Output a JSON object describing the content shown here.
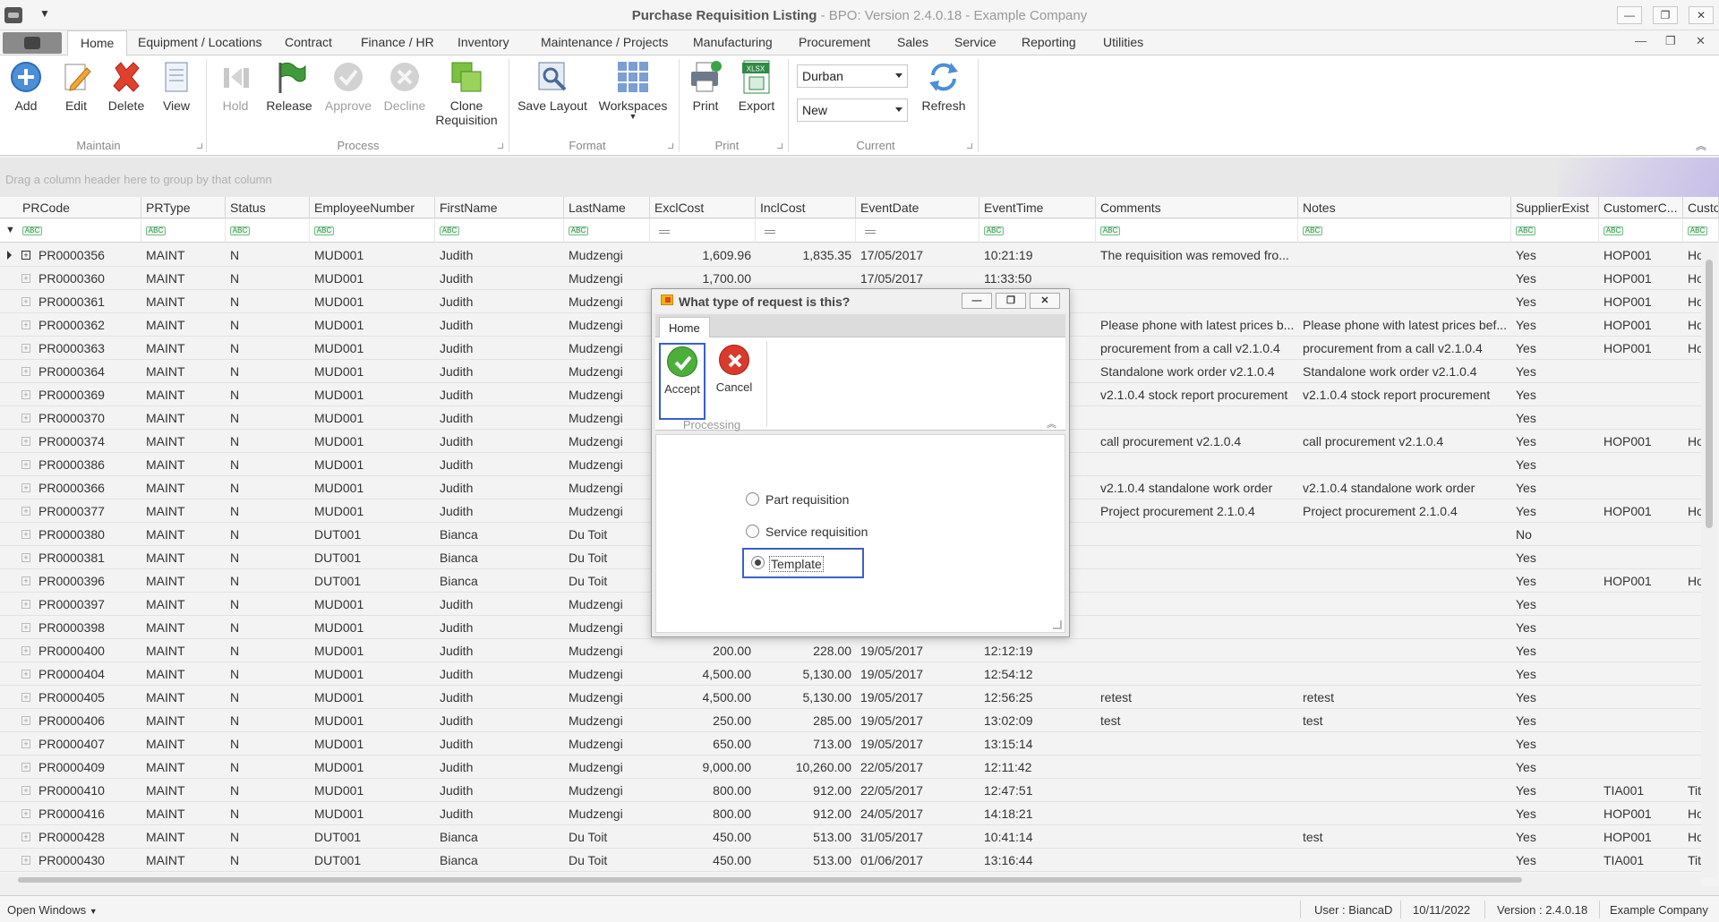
{
  "window": {
    "title": "Purchase Requisition Listing",
    "subtitle": " - BPO: Version 2.4.0.18 - Example Company",
    "min": "—",
    "restore": "❐",
    "close": "✕"
  },
  "menu_tabs": [
    "Home",
    "Equipment / Locations",
    "Contract",
    "Finance / HR",
    "Inventory",
    "Maintenance / Projects",
    "Manufacturing",
    "Procurement",
    "Sales",
    "Service",
    "Reporting",
    "Utilities"
  ],
  "ribbon": {
    "maintain": {
      "label": "Maintain",
      "buttons": [
        "Add",
        "Edit",
        "Delete",
        "View"
      ]
    },
    "process": {
      "label": "Process",
      "buttons": [
        "Hold",
        "Release",
        "Approve",
        "Decline",
        "Clone Requisition"
      ]
    },
    "format": {
      "label": "Format",
      "buttons": [
        "Save Layout",
        "Workspaces"
      ]
    },
    "print": {
      "label": "Print",
      "buttons": [
        "Print",
        "Export"
      ]
    },
    "current": {
      "label": "Current",
      "site": "Durban",
      "status": "New",
      "refresh": "Refresh"
    },
    "export_badge": "XLSX"
  },
  "group_panel_hint": "Drag a column header here to group by that column",
  "grid": {
    "columns": [
      "PRCode",
      "PRType",
      "Status",
      "EmployeeNumber",
      "FirstName",
      "LastName",
      "ExclCost",
      "InclCost",
      "EventDate",
      "EventTime",
      "Comments",
      "Notes",
      "SupplierExist",
      "CustomerC...",
      "Custo"
    ],
    "rows": [
      [
        "PR0000356",
        "MAINT",
        "N",
        "MUD001",
        "Judith",
        "Mudzengi",
        "1,609.96",
        "1,835.35",
        "17/05/2017",
        "10:21:19",
        "The requisition was removed fro...",
        "",
        "Yes",
        "HOP001",
        "Ho"
      ],
      [
        "PR0000360",
        "MAINT",
        "N",
        "MUD001",
        "Judith",
        "Mudzengi",
        "1,700.00",
        "",
        "17/05/2017",
        "11:33:50",
        "",
        "",
        "Yes",
        "HOP001",
        "Ho"
      ],
      [
        "PR0000361",
        "MAINT",
        "N",
        "MUD001",
        "Judith",
        "Mudzengi",
        "",
        "",
        "",
        "",
        "",
        "",
        "Yes",
        "HOP001",
        "Ho"
      ],
      [
        "PR0000362",
        "MAINT",
        "N",
        "MUD001",
        "Judith",
        "Mudzengi",
        "",
        "",
        "",
        "",
        "Please phone with latest prices b...",
        "Please phone with latest prices bef...",
        "Yes",
        "HOP001",
        "Ho"
      ],
      [
        "PR0000363",
        "MAINT",
        "N",
        "MUD001",
        "Judith",
        "Mudzengi",
        "",
        "",
        "",
        "",
        "procurement from a call v2.1.0.4",
        "procurement from a call v2.1.0.4",
        "Yes",
        "HOP001",
        "Ho"
      ],
      [
        "PR0000364",
        "MAINT",
        "N",
        "MUD001",
        "Judith",
        "Mudzengi",
        "",
        "",
        "",
        "",
        "Standalone work order  v2.1.0.4",
        "Standalone work order v2.1.0.4",
        "Yes",
        "",
        ""
      ],
      [
        "PR0000369",
        "MAINT",
        "N",
        "MUD001",
        "Judith",
        "Mudzengi",
        "",
        "",
        "",
        "",
        "v2.1.0.4 stock report procurement",
        "v2.1.0.4 stock report procurement",
        "Yes",
        "",
        ""
      ],
      [
        "PR0000370",
        "MAINT",
        "N",
        "MUD001",
        "Judith",
        "Mudzengi",
        "",
        "",
        "",
        "",
        "",
        "",
        "Yes",
        "",
        ""
      ],
      [
        "PR0000374",
        "MAINT",
        "N",
        "MUD001",
        "Judith",
        "Mudzengi",
        "",
        "",
        "",
        "",
        "call procurement v2.1.0.4",
        "call procurement v2.1.0.4",
        "Yes",
        "HOP001",
        "Ho"
      ],
      [
        "PR0000386",
        "MAINT",
        "N",
        "MUD001",
        "Judith",
        "Mudzengi",
        "",
        "",
        "",
        "",
        "",
        "",
        "Yes",
        "",
        ""
      ],
      [
        "PR0000366",
        "MAINT",
        "N",
        "MUD001",
        "Judith",
        "Mudzengi",
        "",
        "",
        "",
        "",
        "v2.1.0.4 standalone work order",
        "v2.1.0.4 standalone work order",
        "Yes",
        "",
        ""
      ],
      [
        "PR0000377",
        "MAINT",
        "N",
        "MUD001",
        "Judith",
        "Mudzengi",
        "",
        "",
        "",
        "",
        "Project procurement 2.1.0.4",
        "Project procurement 2.1.0.4",
        "Yes",
        "HOP001",
        "Ho"
      ],
      [
        "PR0000380",
        "MAINT",
        "N",
        "DUT001",
        "Bianca",
        "Du Toit",
        "",
        "",
        "",
        "",
        "",
        "",
        "No",
        "",
        ""
      ],
      [
        "PR0000381",
        "MAINT",
        "N",
        "DUT001",
        "Bianca",
        "Du Toit",
        "",
        "",
        "",
        "",
        "",
        "",
        "Yes",
        "",
        ""
      ],
      [
        "PR0000396",
        "MAINT",
        "N",
        "DUT001",
        "Bianca",
        "Du Toit",
        "",
        "",
        "",
        "",
        "",
        "",
        "Yes",
        "HOP001",
        "Ho"
      ],
      [
        "PR0000397",
        "MAINT",
        "N",
        "MUD001",
        "Judith",
        "Mudzengi",
        "",
        "",
        "",
        "",
        "",
        "",
        "Yes",
        "",
        ""
      ],
      [
        "PR0000398",
        "MAINT",
        "N",
        "MUD001",
        "Judith",
        "Mudzengi",
        "",
        "",
        "",
        "",
        "",
        "",
        "Yes",
        "",
        ""
      ],
      [
        "PR0000400",
        "MAINT",
        "N",
        "MUD001",
        "Judith",
        "Mudzengi",
        "200.00",
        "228.00",
        "19/05/2017",
        "12:12:19",
        "",
        "",
        "Yes",
        "",
        ""
      ],
      [
        "PR0000404",
        "MAINT",
        "N",
        "MUD001",
        "Judith",
        "Mudzengi",
        "4,500.00",
        "5,130.00",
        "19/05/2017",
        "12:54:12",
        "",
        "",
        "Yes",
        "",
        ""
      ],
      [
        "PR0000405",
        "MAINT",
        "N",
        "MUD001",
        "Judith",
        "Mudzengi",
        "4,500.00",
        "5,130.00",
        "19/05/2017",
        "12:56:25",
        "retest",
        "retest",
        "Yes",
        "",
        ""
      ],
      [
        "PR0000406",
        "MAINT",
        "N",
        "MUD001",
        "Judith",
        "Mudzengi",
        "250.00",
        "285.00",
        "19/05/2017",
        "13:02:09",
        "test",
        "test",
        "Yes",
        "",
        ""
      ],
      [
        "PR0000407",
        "MAINT",
        "N",
        "MUD001",
        "Judith",
        "Mudzengi",
        "650.00",
        "713.00",
        "19/05/2017",
        "13:15:14",
        "",
        "",
        "Yes",
        "",
        ""
      ],
      [
        "PR0000409",
        "MAINT",
        "N",
        "MUD001",
        "Judith",
        "Mudzengi",
        "9,000.00",
        "10,260.00",
        "22/05/2017",
        "12:11:42",
        "",
        "",
        "Yes",
        "",
        ""
      ],
      [
        "PR0000410",
        "MAINT",
        "N",
        "MUD001",
        "Judith",
        "Mudzengi",
        "800.00",
        "912.00",
        "22/05/2017",
        "12:47:51",
        "",
        "",
        "Yes",
        "TIA001",
        "Tit"
      ],
      [
        "PR0000416",
        "MAINT",
        "N",
        "MUD001",
        "Judith",
        "Mudzengi",
        "800.00",
        "912.00",
        "24/05/2017",
        "14:18:21",
        "",
        "",
        "Yes",
        "HOP001",
        "Ho"
      ],
      [
        "PR0000428",
        "MAINT",
        "N",
        "DUT001",
        "Bianca",
        "Du Toit",
        "450.00",
        "513.00",
        "31/05/2017",
        "10:41:14",
        "",
        "test",
        "Yes",
        "HOP001",
        "Ho"
      ],
      [
        "PR0000430",
        "MAINT",
        "N",
        "DUT001",
        "Bianca",
        "Du Toit",
        "450.00",
        "513.00",
        "01/06/2017",
        "13:16:44",
        "",
        "",
        "Yes",
        "TIA001",
        "Tit"
      ]
    ]
  },
  "statusbar": {
    "open_windows": "Open Windows",
    "user": "User : BiancaD",
    "date": "10/11/2022",
    "version": "Version : 2.4.0.18",
    "company": "Example Company"
  },
  "dialog": {
    "title": "What type of request is this?",
    "tab": "Home",
    "accept": "Accept",
    "cancel": "Cancel",
    "group": "Processing",
    "options": [
      "Part requisition",
      "Service requisition",
      "Template"
    ],
    "selected": "Template"
  },
  "colors": {
    "accent": "#3b5fc9",
    "ok": "#4caf3a",
    "cancel": "#d93a2b"
  }
}
